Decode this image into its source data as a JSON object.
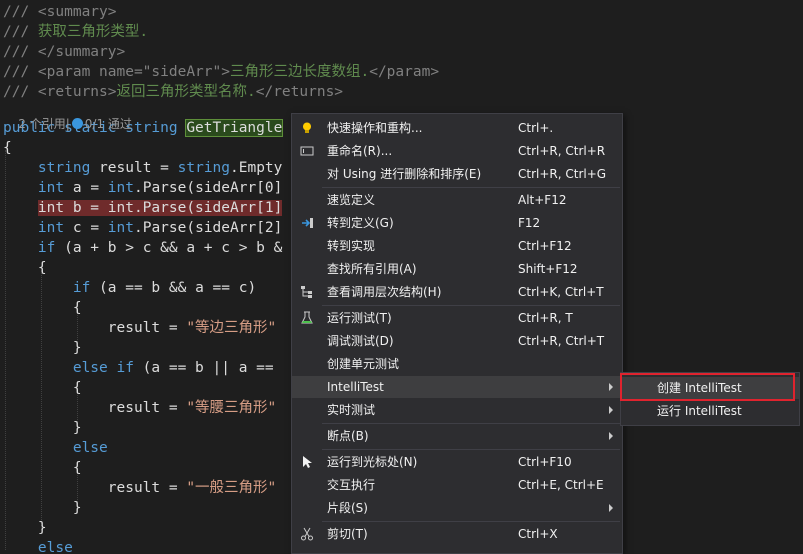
{
  "editor": {
    "lines": [
      [
        {
          "t": "/// ",
          "c": "c-xml"
        },
        {
          "t": "<summary>",
          "c": "c-xml"
        }
      ],
      [
        {
          "t": "/// ",
          "c": "c-xml"
        },
        {
          "t": "获取三角形类型.",
          "c": "c-doc"
        }
      ],
      [
        {
          "t": "/// ",
          "c": "c-xml"
        },
        {
          "t": "</summary>",
          "c": "c-xml"
        }
      ],
      [
        {
          "t": "/// ",
          "c": "c-xml"
        },
        {
          "t": "<param name=\"sideArr\">",
          "c": "c-xml"
        },
        {
          "t": "三角形三边长度数组.",
          "c": "c-doc"
        },
        {
          "t": "</param>",
          "c": "c-xml"
        }
      ],
      [
        {
          "t": "/// ",
          "c": "c-xml"
        },
        {
          "t": "<returns>",
          "c": "c-xml"
        },
        {
          "t": "返回三角形类型名称.",
          "c": "c-doc"
        },
        {
          "t": "</returns>",
          "c": "c-xml"
        }
      ],
      [
        {
          "t": "public static string ",
          "c": "c-kw"
        },
        {
          "t": "GetTriangle",
          "c": "c-plain hl-word"
        }
      ],
      [
        {
          "t": "{",
          "c": "c-plain"
        }
      ],
      [
        {
          "t": "    ",
          "c": "c-plain"
        },
        {
          "t": "string",
          "c": "c-kw"
        },
        {
          "t": " result = ",
          "c": "c-plain"
        },
        {
          "t": "string",
          "c": "c-kw"
        },
        {
          "t": ".Empty",
          "c": "c-plain"
        }
      ],
      [
        {
          "t": "    ",
          "c": "c-plain"
        },
        {
          "t": "int",
          "c": "c-kw"
        },
        {
          "t": " a = ",
          "c": "c-plain"
        },
        {
          "t": "int",
          "c": "c-kw"
        },
        {
          "t": ".Parse(sideArr[0]",
          "c": "c-plain"
        }
      ],
      [
        {
          "t": "    ",
          "c": "c-plain"
        },
        {
          "t": "int b = int.Parse(sideArr[1]",
          "c": "c-plain hl-bp"
        }
      ],
      [
        {
          "t": "    ",
          "c": "c-plain"
        },
        {
          "t": "int",
          "c": "c-kw"
        },
        {
          "t": " c = ",
          "c": "c-plain"
        },
        {
          "t": "int",
          "c": "c-kw"
        },
        {
          "t": ".Parse(sideArr[2]",
          "c": "c-plain"
        }
      ],
      [
        {
          "t": "    ",
          "c": "c-plain"
        },
        {
          "t": "if",
          "c": "c-kw"
        },
        {
          "t": " (a + b > c && a + c > b &",
          "c": "c-plain"
        }
      ],
      [
        {
          "t": "    {",
          "c": "c-plain"
        }
      ],
      [
        {
          "t": "        ",
          "c": "c-plain"
        },
        {
          "t": "if",
          "c": "c-kw"
        },
        {
          "t": " (a == b && a == c)",
          "c": "c-plain"
        }
      ],
      [
        {
          "t": "        {",
          "c": "c-plain"
        }
      ],
      [
        {
          "t": "            result = ",
          "c": "c-plain"
        },
        {
          "t": "\"等边三角形\"",
          "c": "c-str"
        }
      ],
      [
        {
          "t": "        }",
          "c": "c-plain"
        }
      ],
      [
        {
          "t": "        ",
          "c": "c-plain"
        },
        {
          "t": "else if",
          "c": "c-kw"
        },
        {
          "t": " (a == b || a ==",
          "c": "c-plain"
        }
      ],
      [
        {
          "t": "        {",
          "c": "c-plain"
        }
      ],
      [
        {
          "t": "            result = ",
          "c": "c-plain"
        },
        {
          "t": "\"等腰三角形\"",
          "c": "c-str"
        }
      ],
      [
        {
          "t": "        }",
          "c": "c-plain"
        }
      ],
      [
        {
          "t": "        ",
          "c": "c-plain"
        },
        {
          "t": "else",
          "c": "c-kw"
        }
      ],
      [
        {
          "t": "        {",
          "c": "c-plain"
        }
      ],
      [
        {
          "t": "            result = ",
          "c": "c-plain"
        },
        {
          "t": "\"一般三角形\"",
          "c": "c-str"
        }
      ],
      [
        {
          "t": "        }",
          "c": "c-plain"
        }
      ],
      [
        {
          "t": "    }",
          "c": "c-plain"
        }
      ],
      [
        {
          "t": "    ",
          "c": "c-plain"
        },
        {
          "t": "else",
          "c": "c-kw"
        }
      ]
    ],
    "codelens": {
      "refs": "2 个引用",
      "sep": "|",
      "tests": "0/1 通过"
    }
  },
  "menu": {
    "items": [
      {
        "id": "quick-actions",
        "label": "快速操作和重构...",
        "shortcut": "Ctrl+.",
        "icon": "lightbulb-icon"
      },
      {
        "id": "rename",
        "label": "重命名(R)...",
        "shortcut": "Ctrl+R, Ctrl+R",
        "icon": "rename-icon"
      },
      {
        "id": "organize-usings",
        "label": "对 Using 进行删除和排序(E)",
        "shortcut": "Ctrl+R, Ctrl+G",
        "icon": ""
      },
      {
        "sep": true
      },
      {
        "id": "peek-definition",
        "label": "速览定义",
        "shortcut": "Alt+F12",
        "icon": ""
      },
      {
        "id": "go-to-definition",
        "label": "转到定义(G)",
        "shortcut": "F12",
        "icon": "go-to-definition-icon"
      },
      {
        "id": "go-to-implementation",
        "label": "转到实现",
        "shortcut": "Ctrl+F12",
        "icon": ""
      },
      {
        "id": "find-all-references",
        "label": "查找所有引用(A)",
        "shortcut": "Shift+F12",
        "icon": ""
      },
      {
        "id": "call-hierarchy",
        "label": "查看调用层次结构(H)",
        "shortcut": "Ctrl+K, Ctrl+T",
        "icon": "call-hierarchy-icon"
      },
      {
        "sep": true
      },
      {
        "id": "run-tests",
        "label": "运行测试(T)",
        "shortcut": "Ctrl+R, T",
        "icon": "run-tests-icon"
      },
      {
        "id": "debug-tests",
        "label": "调试测试(D)",
        "shortcut": "Ctrl+R, Ctrl+T",
        "icon": ""
      },
      {
        "id": "create-unit-tests",
        "label": "创建单元测试",
        "shortcut": "",
        "icon": ""
      },
      {
        "id": "intellitest",
        "label": "IntelliTest",
        "shortcut": "",
        "icon": "",
        "submenu": true,
        "hover": true
      },
      {
        "id": "live-testing",
        "label": "实时测试",
        "shortcut": "",
        "icon": "",
        "submenu": true
      },
      {
        "sep": true
      },
      {
        "id": "breakpoint",
        "label": "断点(B)",
        "shortcut": "",
        "icon": "",
        "submenu": true
      },
      {
        "sep": true
      },
      {
        "id": "run-to-cursor",
        "label": "运行到光标处(N)",
        "shortcut": "Ctrl+F10",
        "icon": "cursor-arrow-icon"
      },
      {
        "id": "interactive",
        "label": "交互执行",
        "shortcut": "Ctrl+E, Ctrl+E",
        "icon": ""
      },
      {
        "id": "snippet",
        "label": "片段(S)",
        "shortcut": "",
        "icon": "",
        "submenu": true
      },
      {
        "sep": true
      },
      {
        "id": "cut",
        "label": "剪切(T)",
        "shortcut": "Ctrl+X",
        "icon": "scissors-icon"
      }
    ]
  },
  "submenu": {
    "items": [
      {
        "id": "create-intellitest",
        "label": "创建 IntelliTest",
        "hover": true
      },
      {
        "id": "run-intellitest",
        "label": "运行 IntelliTest"
      }
    ]
  },
  "colors": {
    "highlight_box": "#e0232e",
    "menu_bg": "#2d2d30",
    "editor_bg": "#1e1e1e"
  }
}
